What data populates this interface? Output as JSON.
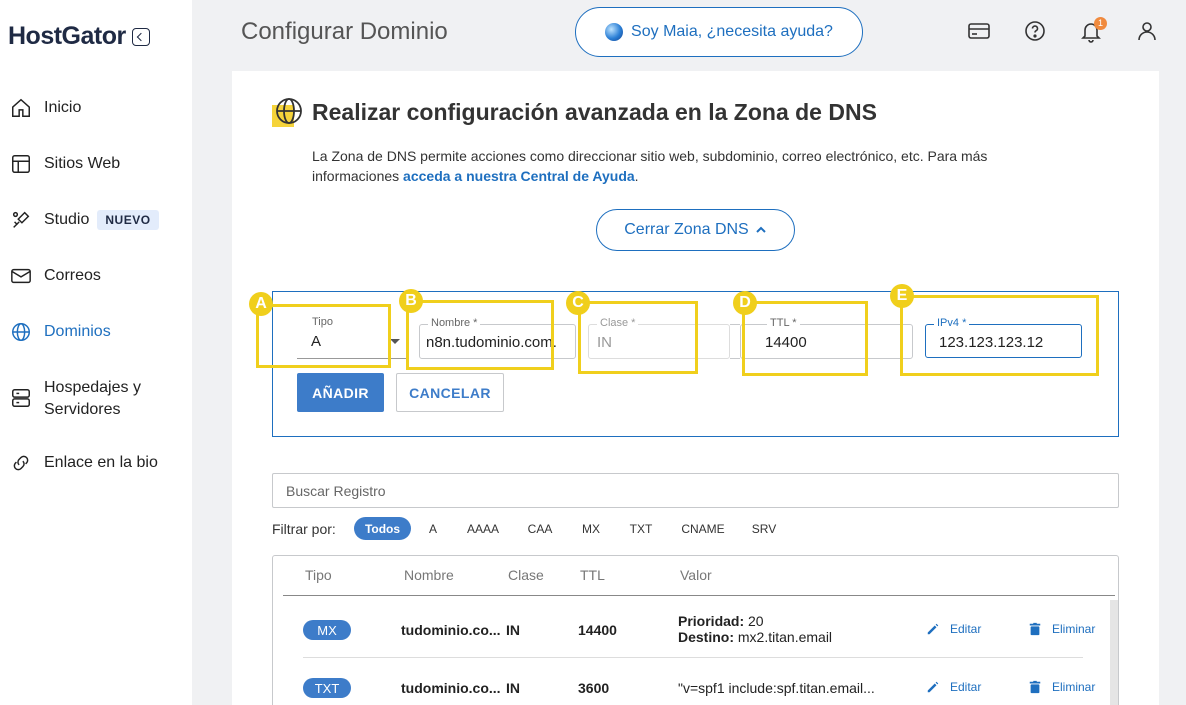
{
  "app": {
    "logo": "HostGator"
  },
  "sidebar": {
    "items": [
      {
        "label": "Inicio",
        "icon": "home-icon"
      },
      {
        "label": "Sitios Web",
        "icon": "layout-icon"
      },
      {
        "label": "Studio",
        "icon": "brush-icon",
        "badge": "NUEVO"
      },
      {
        "label": "Correos",
        "icon": "mail-icon"
      },
      {
        "label": "Dominios",
        "icon": "globe-icon",
        "active": true
      },
      {
        "label": "Hospedajes y",
        "label2": "Servidores",
        "icon": "server-icon"
      },
      {
        "label": "Enlace en la bio",
        "icon": "link-icon"
      }
    ]
  },
  "header": {
    "title": "Configurar Dominio",
    "maia": "Soy Maia, ¿necesita ayuda?",
    "notifications_count": "1"
  },
  "section": {
    "title": "Realizar configuración avanzada en la Zona de DNS",
    "desc_part1": "La Zona de DNS permite acciones como direccionar sitio web, subdominio, correo electrónico, etc. Para más informaciones ",
    "desc_link": "acceda a nuestra Central de Ayuda",
    "desc_end": ".",
    "close_button": "Cerrar Zona DNS"
  },
  "form": {
    "tipo": {
      "label": "Tipo",
      "value": "A"
    },
    "nombre": {
      "label": "Nombre *",
      "value": "n8n.tudominio.com."
    },
    "clase": {
      "label": "Clase *",
      "value": "IN"
    },
    "ttl": {
      "label": "TTL *",
      "value": "14400"
    },
    "ipv4": {
      "label": "IPv4 *",
      "value": "123.123.123.12"
    },
    "add_button": "AÑADIR",
    "cancel_button": "CANCELAR"
  },
  "annotations": [
    "A",
    "B",
    "C",
    "D",
    "E"
  ],
  "search": {
    "placeholder": "Buscar Registro"
  },
  "filters": {
    "label": "Filtrar por:",
    "options": [
      "Todos",
      "A",
      "AAAA",
      "CAA",
      "MX",
      "TXT",
      "CNAME",
      "SRV"
    ],
    "active": "Todos"
  },
  "table": {
    "headers": [
      "Tipo",
      "Nombre",
      "Clase",
      "TTL",
      "Valor"
    ],
    "rows": [
      {
        "tipo": "MX",
        "nombre": "tudominio.co...",
        "clase": "IN",
        "ttl": "14400",
        "valor_label1": "Prioridad:",
        "valor1": " 20",
        "valor_label2": "Destino:",
        "valor2": " mx2.titan.email",
        "edit": "Editar",
        "delete": "Eliminar"
      },
      {
        "tipo": "TXT",
        "nombre": "tudominio.co...",
        "clase": "IN",
        "ttl": "3600",
        "valor": "\"v=spf1 include:spf.titan.email...",
        "edit": "Editar",
        "delete": "Eliminar"
      }
    ]
  },
  "colors": {
    "accent": "#1e6fbf",
    "highlight": "#f0cf1c",
    "notification": "#f08a3e"
  }
}
